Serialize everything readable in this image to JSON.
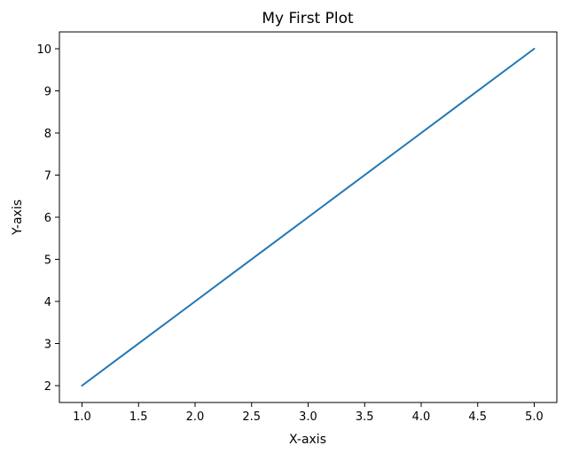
{
  "chart_data": {
    "type": "line",
    "title": "My First Plot",
    "xlabel": "X-axis",
    "ylabel": "Y-axis",
    "x": [
      1,
      2,
      3,
      4,
      5
    ],
    "series": [
      {
        "name": "line",
        "color": "#1f77b4",
        "values": [
          2,
          4,
          6,
          8,
          10
        ]
      }
    ],
    "xlim": [
      0.8,
      5.2
    ],
    "ylim": [
      1.6,
      10.4
    ],
    "xticks": [
      1.0,
      1.5,
      2.0,
      2.5,
      3.0,
      3.5,
      4.0,
      4.5,
      5.0
    ],
    "xtick_labels": [
      "1.0",
      "1.5",
      "2.0",
      "2.5",
      "3.0",
      "3.5",
      "4.0",
      "4.5",
      "5.0"
    ],
    "yticks": [
      2,
      3,
      4,
      5,
      6,
      7,
      8,
      9,
      10
    ],
    "ytick_labels": [
      "2",
      "3",
      "4",
      "5",
      "6",
      "7",
      "8",
      "9",
      "10"
    ],
    "grid": false,
    "legend": null
  }
}
